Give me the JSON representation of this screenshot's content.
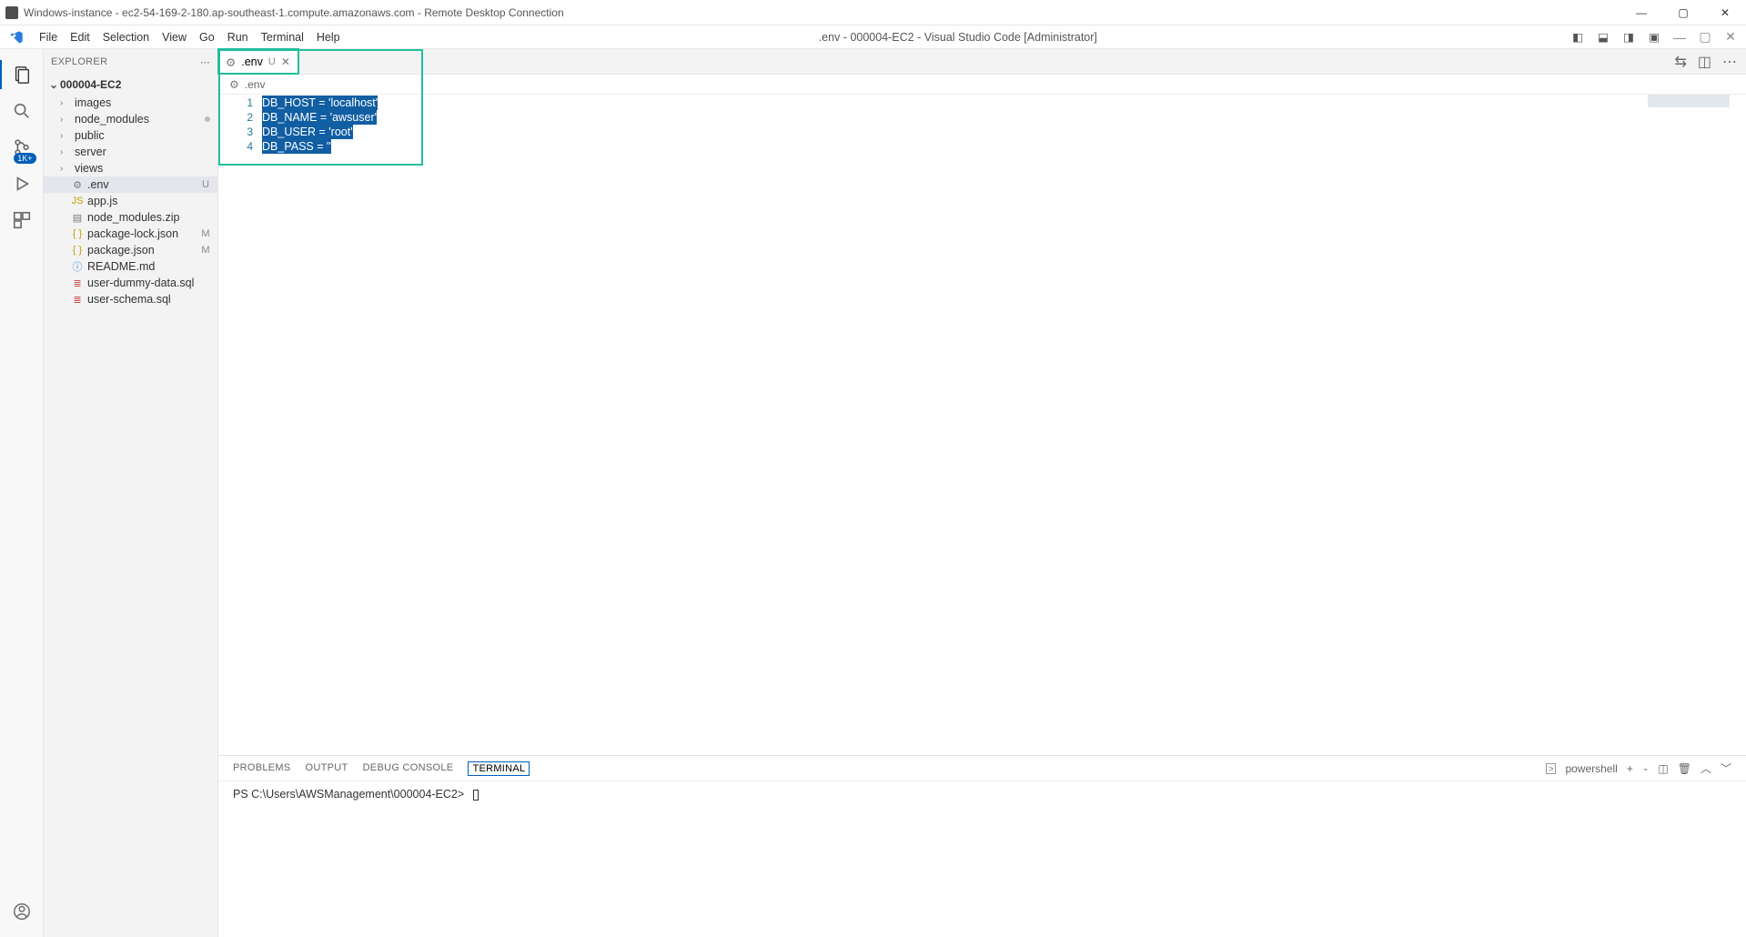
{
  "rdp": {
    "title": "Windows-instance - ec2-54-169-2-180.ap-southeast-1.compute.amazonaws.com - Remote Desktop Connection"
  },
  "menubar": {
    "items": [
      "File",
      "Edit",
      "Selection",
      "View",
      "Go",
      "Run",
      "Terminal",
      "Help"
    ],
    "title": ".env - 000004-EC2 - Visual Studio Code [Administrator]"
  },
  "activitybar": {
    "scm_badge": "1K+"
  },
  "sidebar": {
    "title": "EXPLORER",
    "project": "000004-EC2",
    "folders": [
      {
        "name": "images",
        "type": "folder"
      },
      {
        "name": "node_modules",
        "type": "folder",
        "dot": true
      },
      {
        "name": "public",
        "type": "folder"
      },
      {
        "name": "server",
        "type": "folder"
      },
      {
        "name": "views",
        "type": "folder"
      }
    ],
    "files": [
      {
        "name": ".env",
        "icon": "gear",
        "status": "U",
        "selected": true
      },
      {
        "name": "app.js",
        "icon": "js",
        "status": ""
      },
      {
        "name": "node_modules.zip",
        "icon": "zip",
        "status": ""
      },
      {
        "name": "package-lock.json",
        "icon": "json",
        "status": "M"
      },
      {
        "name": "package.json",
        "icon": "json",
        "status": "M"
      },
      {
        "name": "README.md",
        "icon": "info",
        "status": ""
      },
      {
        "name": "user-dummy-data.sql",
        "icon": "sql",
        "status": ""
      },
      {
        "name": "user-schema.sql",
        "icon": "sql",
        "status": ""
      }
    ]
  },
  "editor": {
    "tab": {
      "name": ".env",
      "status": "U"
    },
    "breadcrumb": ".env",
    "lines": [
      "DB_HOST = 'localhost'",
      "DB_NAME = 'awsuser'",
      "DB_USER = 'root'",
      "DB_PASS = ''"
    ],
    "line_numbers": [
      "1",
      "2",
      "3",
      "4"
    ]
  },
  "panel": {
    "tabs": [
      "PROBLEMS",
      "OUTPUT",
      "DEBUG CONSOLE",
      "TERMINAL"
    ],
    "active_tab": "TERMINAL",
    "shell_label": "powershell",
    "prompt": "PS C:\\Users\\AWSManagement\\000004-EC2>"
  }
}
